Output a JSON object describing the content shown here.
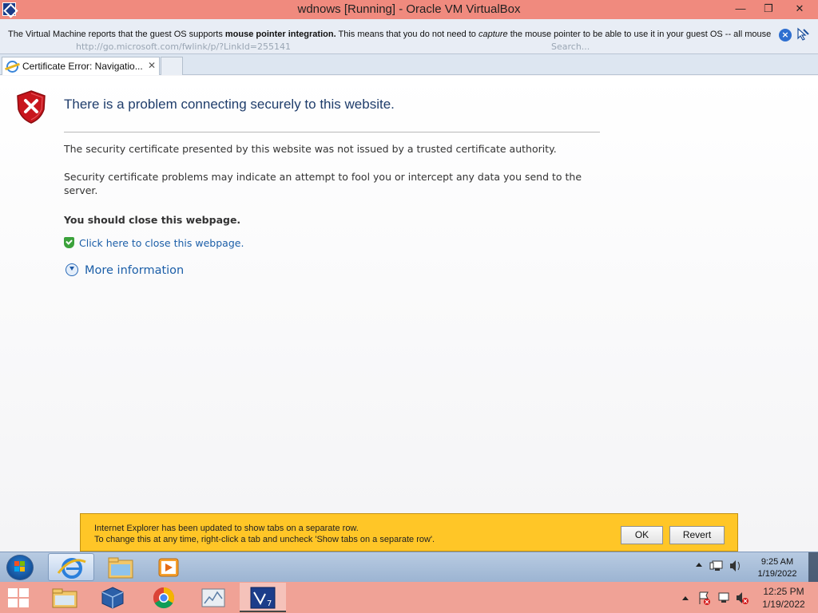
{
  "host_window": {
    "title": "wdnows [Running] - Oracle VM VirtualBox",
    "minimize_glyph": "—",
    "maximize_glyph": "❐",
    "close_glyph": "✕"
  },
  "vbox_notification": {
    "text_part1": "The Virtual Machine reports that the guest OS supports ",
    "text_bold": "mouse pointer integration.",
    "text_part2": " This means that you do not need to ",
    "text_italic": "capture",
    "text_part3": " the mouse pointer to be able to use it in your guest OS -- all mouse",
    "ghost_url": "http://go.microsoft.com/fwlink/p/?LinkId=255141",
    "ghost_search": "Search..."
  },
  "browser": {
    "tab_label": "Certificate Error: Navigatio...",
    "tab_close": "✕"
  },
  "page": {
    "heading": "There is a problem connecting securely to this website.",
    "para1": "The security certificate presented by this website was not issued by a trusted certificate authority.",
    "para2": "Security certificate problems may indicate an attempt to fool you or intercept any data you send to the server.",
    "warning": "You should close this webpage.",
    "close_link": "Click here to close this webpage.",
    "more_info": "More information"
  },
  "infobar": {
    "line1": "Internet Explorer has been updated to show tabs on a separate row.",
    "line2": "To change this at any time, right-click a tab and uncheck 'Show tabs on a separate row'.",
    "ok_label": "OK",
    "revert_label": "Revert"
  },
  "guest_taskbar": {
    "time": "9:25 AM",
    "date": "1/19/2022",
    "pinned": [
      "internet-explorer-icon",
      "file-explorer-icon",
      "media-player-icon"
    ]
  },
  "host_taskbar": {
    "time": "12:25 PM",
    "date": "1/19/2022",
    "pinned": [
      "file-explorer-icon",
      "virtualbox-icon",
      "chrome-icon",
      "system-monitor-icon",
      "virtualbox-vm-icon"
    ]
  },
  "colors": {
    "host_title_bar": "#f08a7e",
    "link_blue": "#1b5ea8",
    "heading_blue": "#1f3d6b",
    "infobar_yellow": "#ffc627",
    "error_red": "#c8161d"
  }
}
